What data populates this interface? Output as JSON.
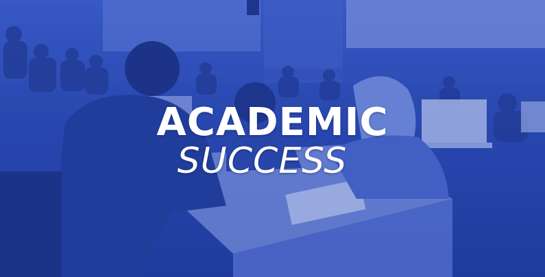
{
  "banner": {
    "headline": "ACADEMIC",
    "subhead": "SUCCESS",
    "tint_color": "#2b48b0",
    "text_color": "#ffffff"
  },
  "scene": {
    "description_icon": "lecture-hall-photo"
  }
}
